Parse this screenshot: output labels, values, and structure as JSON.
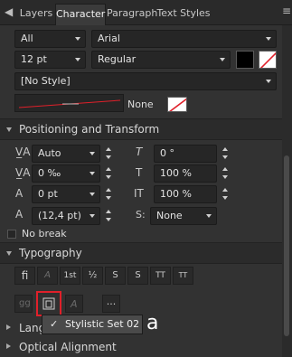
{
  "tabs": [
    {
      "label": "Layers",
      "active": false
    },
    {
      "label": "Character",
      "active": true
    },
    {
      "label": "Paragraph",
      "active": false
    },
    {
      "label": "Text Styles",
      "active": false
    }
  ],
  "font": {
    "collection": "All",
    "family": "Arial",
    "size": "12 pt",
    "style": "Regular",
    "text_style": "[No Style]",
    "stroke_label": "None"
  },
  "positioning": {
    "title": "Positioning and Transform",
    "kerning": "Auto",
    "tracking": "0 ‰",
    "baseline": "0 pt",
    "leading": "(12,4 pt)",
    "shear": "0 °",
    "vscale": "100 %",
    "hscale": "100 %",
    "transform": "None",
    "transform_label": "S:",
    "no_break": "No break"
  },
  "typography": {
    "title": "Typography",
    "buttons": [
      "fi",
      "A",
      "1st",
      "½",
      "S",
      "S",
      "TT",
      "TT"
    ],
    "ellipsis": "...",
    "popup_item": "Stylistic Set 02",
    "popup_preview": "a"
  },
  "sections": {
    "language": "Language",
    "optical": "Optical Alignment"
  },
  "colors": {
    "panel": "#323232",
    "highlight": "#e0202a"
  }
}
